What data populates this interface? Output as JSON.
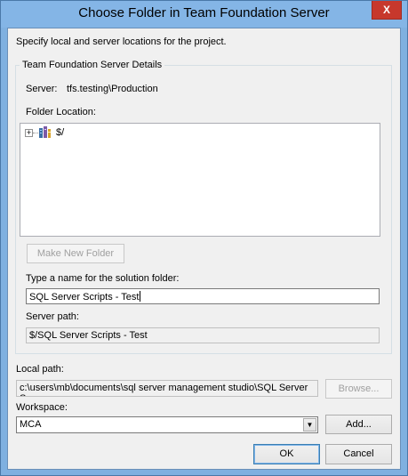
{
  "window": {
    "title": "Choose Folder in Team Foundation Server",
    "close_glyph": "X"
  },
  "instructions": "Specify local and server locations for the project.",
  "group": {
    "legend": "Team Foundation Server Details",
    "server_label": "Server:",
    "server_value": "tfs.testing\\Production",
    "folder_location_label": "Folder Location:",
    "tree": {
      "expander": "+",
      "root_label": "$/",
      "root_icon": "server-folder-icon"
    },
    "make_new_folder_label": "Make New Folder",
    "solution_folder_label": "Type a name for the solution folder:",
    "solution_folder_value": "SQL Server Scripts - Test",
    "server_path_label": "Server path:",
    "server_path_value": "$/SQL Server Scripts - Test"
  },
  "local_path": {
    "label": "Local path:",
    "value": "c:\\users\\mb\\documents\\sql server management studio\\SQL Server Sc",
    "browse_label": "Browse..."
  },
  "workspace": {
    "label": "Workspace:",
    "selected": "MCA",
    "add_label": "Add..."
  },
  "buttons": {
    "ok": "OK",
    "cancel": "Cancel"
  },
  "colors": {
    "title_bar": "#84b5e6",
    "close_button": "#c7382c",
    "client": "#f0f0f0"
  }
}
